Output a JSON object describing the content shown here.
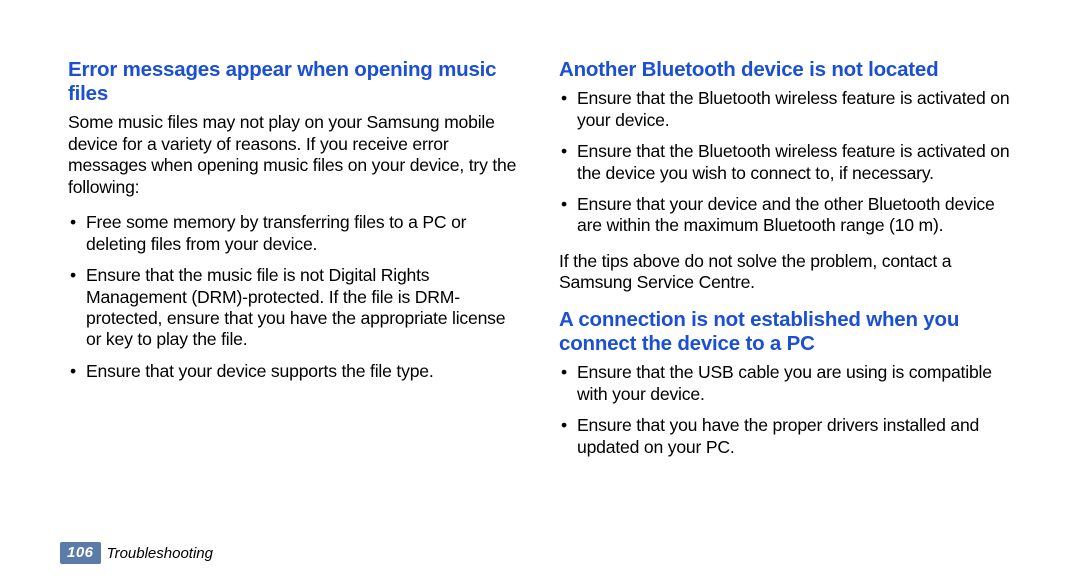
{
  "left": {
    "heading": "Error messages appear when opening music files",
    "intro": "Some music files may not play on your Samsung mobile device for a variety of reasons. If you receive error messages when opening music files on your device, try the following:",
    "items": [
      "Free some memory by transferring files to a PC or deleting files from your device.",
      "Ensure that the music file is not Digital Rights Management (DRM)-protected. If the file is DRM-protected, ensure that you have the appropriate license or key to play the file.",
      "Ensure that your device supports the file type."
    ]
  },
  "right": {
    "heading1": "Another Bluetooth device is not located",
    "bt_items": [
      "Ensure that the Bluetooth wireless feature is activated on your device.",
      "Ensure that the Bluetooth wireless feature is activated on the device you wish to connect to, if necessary.",
      "Ensure that your device and the other Bluetooth device are within the maximum Bluetooth range (10 m)."
    ],
    "bt_outro": "If the tips above do not solve the problem, contact a Samsung Service Centre.",
    "heading2": "A connection is not established when you connect the device to a PC",
    "pc_items": [
      "Ensure that the USB cable you are using is compatible with your device.",
      "Ensure that you have the proper drivers installed and updated on your PC."
    ]
  },
  "footer": {
    "page": "106",
    "section": "Troubleshooting"
  }
}
